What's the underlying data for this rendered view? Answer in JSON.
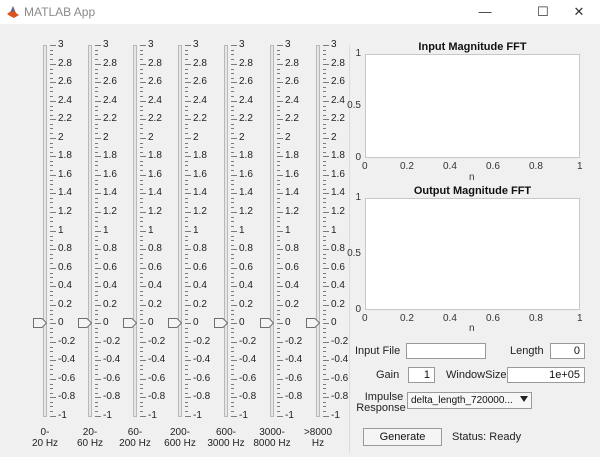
{
  "window": {
    "title": "MATLAB App",
    "minimize_glyph": "—",
    "maximize_glyph": "☐",
    "close_glyph": "✕",
    "icon": "matlab-logo-icon"
  },
  "sliders": {
    "ticks": [
      "3",
      "2.8",
      "2.6",
      "2.4",
      "2.2",
      "2",
      "1.8",
      "1.6",
      "1.4",
      "1.2",
      "1",
      "0.8",
      "0.6",
      "0.4",
      "0.2",
      "0",
      "-0.2",
      "-0.4",
      "-0.6",
      "-0.8",
      "-1"
    ],
    "range": [
      -1,
      3
    ],
    "bands": [
      {
        "label": "0-\n20 Hz",
        "value": 0
      },
      {
        "label": "20-\n60 Hz",
        "value": 0
      },
      {
        "label": "60-\n200 Hz",
        "value": 0
      },
      {
        "label": "200-\n600 Hz",
        "value": 0
      },
      {
        "label": "600-\n3000 Hz",
        "value": 0
      },
      {
        "label": "3000-\n8000 Hz",
        "value": 0
      },
      {
        "label": ">8000\nHz",
        "value": 0
      }
    ]
  },
  "input_fft": {
    "title": "Input Magnitude FFT",
    "xlabel": "n",
    "xticks": [
      "0",
      "0.2",
      "0.4",
      "0.6",
      "0.8",
      "1"
    ],
    "yticks": [
      "1",
      "0.5",
      "0"
    ]
  },
  "output_fft": {
    "title": "Output Magnitude FFT",
    "xlabel": "n",
    "xticks": [
      "0",
      "0.2",
      "0.4",
      "0.6",
      "0.8",
      "1"
    ],
    "yticks": [
      "1",
      "0.5",
      "0"
    ]
  },
  "controls": {
    "input_file_label": "Input File",
    "input_file_value": "",
    "length_label": "Length",
    "length_value": "0",
    "gain_label": "Gain",
    "gain_value": "1",
    "window_label": "WindowSize",
    "window_value": "1e+05",
    "impulse_label_1": "Impulse",
    "impulse_label_2": "Response",
    "impulse_value": "delta_length_720000...",
    "generate_label": "Generate",
    "status": "Status: Ready"
  },
  "colors": {
    "background": "#f0f0f0",
    "axes_background": "#ffffff"
  }
}
